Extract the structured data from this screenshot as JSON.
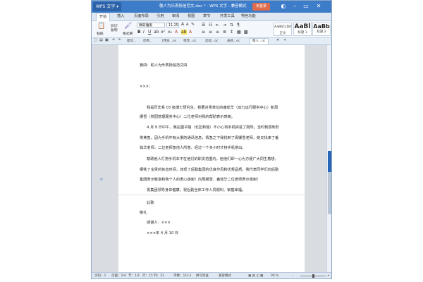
{
  "window": {
    "app_button": "WPS 文字 ▾",
    "title": "敬人为乐表扬信范文.doc * - WPS 文字 - 兼容模式",
    "login": "未登录"
  },
  "menu_tabs": [
    "开始",
    "插入",
    "页面布局",
    "引用",
    "审阅",
    "视图",
    "章节",
    "开发工具",
    "特色功能"
  ],
  "ribbon": {
    "paste": "粘贴",
    "cut": "剪切",
    "copy": "复制",
    "format_painter": "格式刷",
    "font_name": "微软雅黑",
    "font_size": "11.25",
    "styles": [
      {
        "sample": "AaBbCcDd",
        "label": "正文"
      },
      {
        "sample": "AaBl",
        "label": "标题 1"
      },
      {
        "sample": "AaBb",
        "label": "标题 2"
      }
    ]
  },
  "doc_tabs": [
    "提货...",
    "优秀...",
    "[预览...oc",
    "更改...oc",
    "动动...oc",
    "表扬...oc",
    "敬人...oc"
  ],
  "document": {
    "lines": [
      "篇四：助人为乐表扬信范文四",
      "×××：",
      "我是历史系 03 级博士研究生，我要对贵单位的番茹华（动力运行服务中心）和周",
      "娜雪（校园管理服务中心）二位老师对我的帮助表示感谢。",
      "4 月 9 日中午，我在图书馆（北区新馆）不小心将手机掉进了厕所。当时我感到非",
      "常焦急，因为手机中有大量的通讯信息，情急之下我找到了周娜雪老师，她又找来了番",
      "茹华老师，二位老师急他人所急，经过一个多小时才将手机捞出。",
      "帮助他人打捞手机本不在他们的职责范围内，但他们却一心为方便广大同生着想，",
      "牺牲了宝贵的休息时间，体现了后勤集团的优良作风和优秀品质。我代表同学们向后勤",
      "集团表示敬意和我个人的衷心感谢！向周娜雪、番茹华二位老师表示感谢！",
      "祝集团领导身体健康，祝后勤全体工作人员顺利、家庭幸福。",
      "此致",
      "敬礼",
      "感谢人：×××",
      "×××年 4 月 10 日"
    ]
  },
  "status": {
    "page": "页码：1",
    "pages": "页面：1/4",
    "section": "节：1/1",
    "position": "行：15  列：21",
    "words": "字数：1113",
    "spellcheck": "拼写检查",
    "mode": "兼容模式",
    "zoom": "90 %"
  }
}
